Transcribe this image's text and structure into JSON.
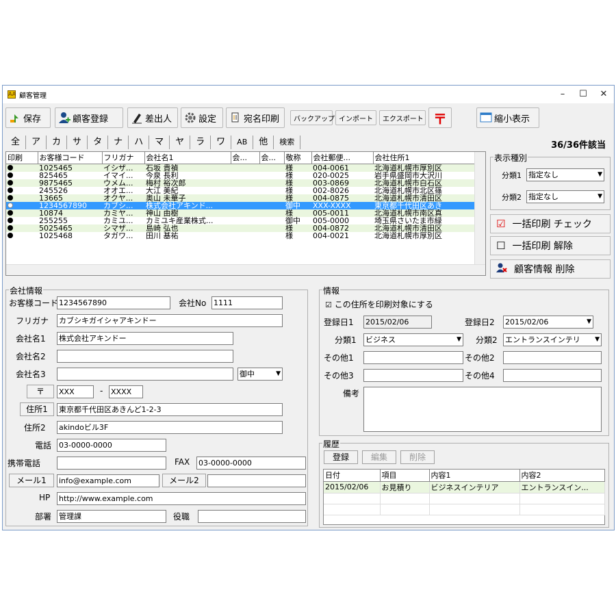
{
  "window": {
    "title": "顧客管理",
    "minimize": "–",
    "maximize": "☐",
    "close": "✕"
  },
  "toolbar": {
    "save": "保存",
    "register": "顧客登録",
    "sender": "差出人",
    "settings": "設定",
    "print_labels": "宛名印刷",
    "backup": "バックアップ",
    "import": "インポート",
    "export": "エクスポート",
    "postal_mark": "〒",
    "minimize_view": "縮小表示"
  },
  "tabs": [
    "全",
    "ア",
    "カ",
    "サ",
    "タ",
    "ナ",
    "ハ",
    "マ",
    "ヤ",
    "ラ",
    "ワ",
    "AB",
    "他",
    "検索"
  ],
  "count": "36/36件該当",
  "grid": {
    "headers": [
      "印刷",
      "お客様コード",
      "フリガナ",
      "会社名1",
      "会...",
      "会...",
      "敬称",
      "会社郵便...",
      "会社住所1"
    ],
    "rows": [
      [
        "1025465",
        "イシザ...",
        "石坂 貴禎",
        "",
        "",
        "様",
        "004-0061",
        "北海道札幌市厚別区"
      ],
      [
        "825465",
        "イマイ...",
        "今泉 長利",
        "",
        "",
        "様",
        "020-0025",
        "岩手県盛岡市大沢川"
      ],
      [
        "9875465",
        "ウメム...",
        "梅村 裕次郎",
        "",
        "",
        "様",
        "003-0869",
        "北海道札幌市白石区"
      ],
      [
        "245526",
        "オオエ...",
        "大江 美紀",
        "",
        "",
        "様",
        "002-8026",
        "北海道札幌市北区篠"
      ],
      [
        "13665",
        "オクヤ...",
        "奥山 未華子",
        "",
        "",
        "様",
        "004-0875",
        "北海道札幌市清田区"
      ],
      [
        "1234567890",
        "カブシ...",
        "株式会社アキンド...",
        "",
        "",
        "御中",
        "XXX-XXXX",
        "東京都千代田区あき"
      ],
      [
        "10874",
        "カミヤ...",
        "神山 由樹",
        "",
        "",
        "様",
        "005-0011",
        "北海道札幌市南区真"
      ],
      [
        "255255",
        "カミユ...",
        "カミユキ産業株式...",
        "",
        "",
        "御中",
        "005-0000",
        "埼玉県さいたま市緑"
      ],
      [
        "5025465",
        "シマザ...",
        "島崎 弘也",
        "",
        "",
        "様",
        "004-0872",
        "北海道札幌市清田区"
      ],
      [
        "1025468",
        "タガワ...",
        "田川 基祐",
        "",
        "",
        "様",
        "004-0021",
        "北海道札幌市厚別区"
      ]
    ],
    "selected_index": 5
  },
  "display_type": {
    "label": "表示種別",
    "class1_label": "分類1",
    "class1_value": "指定なし",
    "class2_label": "分類2",
    "class2_value": "指定なし"
  },
  "side": {
    "check_all": "一括印刷 チェック",
    "uncheck_all": "一括印刷 解除",
    "delete_customer": "顧客情報 削除"
  },
  "company": {
    "group_label": "会社情報",
    "code_label": "お客様コード",
    "code": "1234567890",
    "no_label": "会社No",
    "no": "1111",
    "furigana_label": "フリガナ",
    "furigana": "カブシキガイシャアキンドー",
    "name1_label": "会社名1",
    "name1": "株式会社アキンドー",
    "name2_label": "会社名2",
    "name2": "",
    "name3_label": "会社名3",
    "name3": "",
    "honorific": "御中",
    "postal_btn": "〒",
    "postal1": "XXX",
    "dash": "-",
    "postal2": "XXXX",
    "addr1_btn": "住所1",
    "addr1": "東京都千代田区あきんど1-2-3",
    "addr2_label": "住所2",
    "addr2": "akindoビル3F",
    "phone_label": "電話",
    "phone": "03-0000-0000",
    "mobile_label": "携帯電話",
    "mobile": "",
    "fax_label": "FAX",
    "fax": "03-0000-0000",
    "mail1_btn": "メール1",
    "mail1": "info@example.com",
    "mail2_btn": "メール2",
    "mail2": "",
    "hp_label": "HP",
    "hp": "http://www.example.com",
    "dept_label": "部署",
    "dept": "管理課",
    "title_label": "役職",
    "title": ""
  },
  "info": {
    "group_label": "情報",
    "print_target": "この住所を印刷対象にする",
    "date1_label": "登録日1",
    "date1": "2015/02/06",
    "date2_label": "登録日2",
    "date2": "2015/02/06",
    "class1_label": "分類1",
    "class1": "ビジネス",
    "class2_label": "分類2",
    "class2": "エントランスインテリ",
    "other1_label": "その他1",
    "other1": "",
    "other2_label": "その他2",
    "other2": "",
    "other3_label": "その他3",
    "other3": "",
    "other4_label": "その他4",
    "other4": "",
    "memo_label": "備考",
    "memo": ""
  },
  "history": {
    "group_label": "履歴",
    "register": "登録",
    "edit": "編集",
    "delete": "削除",
    "headers": [
      "日付",
      "項目",
      "内容1",
      "内容2"
    ],
    "rows": [
      [
        "2015/02/06",
        "お見積り",
        "ビジネスインテリア",
        "エントランスイン..."
      ]
    ]
  },
  "colors": {
    "selection": "#3399ff",
    "row_alt": "#eaf6df",
    "postal_red": "#e00000"
  }
}
